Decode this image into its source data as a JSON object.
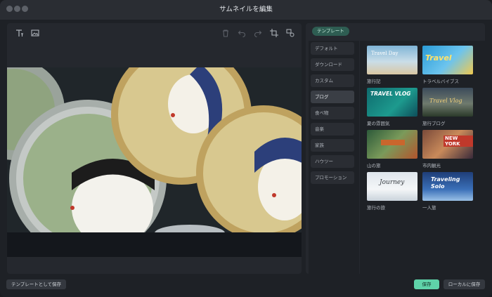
{
  "window": {
    "title": "サムネイルを編集"
  },
  "toolbar": {
    "tools": [
      {
        "name": "text-tool-icon",
        "glyph": "T"
      },
      {
        "name": "image-tool-icon",
        "glyph": "▣"
      },
      {
        "name": "delete-icon",
        "glyph": "🗑"
      },
      {
        "name": "undo-icon",
        "glyph": "↶"
      },
      {
        "name": "redo-icon",
        "glyph": "↷"
      },
      {
        "name": "crop-icon",
        "glyph": "⌗"
      },
      {
        "name": "replace-image-icon",
        "glyph": "⇄"
      }
    ]
  },
  "templates_panel": {
    "tab_label": "テンプレート",
    "categories": [
      {
        "label": "デフォルト",
        "active": false
      },
      {
        "label": "ダウンロード",
        "active": false
      },
      {
        "label": "カスタム",
        "active": false
      },
      {
        "label": "ブログ",
        "active": true
      },
      {
        "label": "食べ物",
        "active": false
      },
      {
        "label": "音楽",
        "active": false
      },
      {
        "label": "家族",
        "active": false
      },
      {
        "label": "ハウツー",
        "active": false
      },
      {
        "label": "プロモーション",
        "active": false
      }
    ],
    "items": [
      {
        "label": "旅行記",
        "overlay": "Travel Day"
      },
      {
        "label": "トラベルバイブス",
        "overlay": "Travel"
      },
      {
        "label": "夏の雰囲気",
        "overlay": "TRAVEL VLOG"
      },
      {
        "label": "旅行ブログ",
        "overlay": "Travel Vlog"
      },
      {
        "label": "山の旅",
        "overlay": ""
      },
      {
        "label": "市内観光",
        "overlay": "NEW YORK"
      },
      {
        "label": "旅行の旅",
        "overlay": "Journey"
      },
      {
        "label": "一人旅",
        "overlay": "Traveling Solo"
      }
    ]
  },
  "footer": {
    "save_as_template": "テンプレートとして保存",
    "save": "保存",
    "save_local": "ローカルに保存"
  },
  "colors": {
    "accent": "#5fd3a9",
    "tab_bg": "#2e5d52",
    "panel_bg": "#25282e"
  }
}
